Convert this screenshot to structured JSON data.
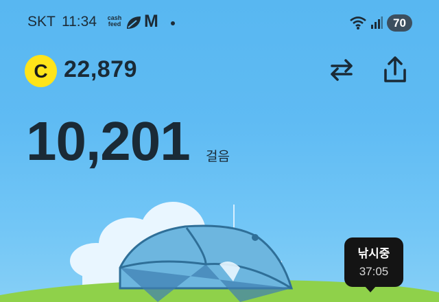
{
  "status_bar": {
    "carrier": "SKT",
    "time": "11:34",
    "cashfeed_label": "cash feed",
    "m_label": "M",
    "battery": "70",
    "icons": [
      "leaf-icon",
      "m-icon",
      "dot-icon",
      "wifi-icon",
      "signal-icon"
    ]
  },
  "header": {
    "coin_symbol": "C",
    "coin_balance": "22,879",
    "icons": [
      "swap-icon",
      "share-icon"
    ]
  },
  "steps": {
    "count": "10,201",
    "unit": "걸음"
  },
  "fishing": {
    "label": "낚시중",
    "timer": "37:05"
  },
  "colors": {
    "sky": "#5fbbf3",
    "coin": "#ffe41a",
    "badge": "#141414",
    "text": "#1a2a36",
    "grass": "#8fd14a"
  }
}
